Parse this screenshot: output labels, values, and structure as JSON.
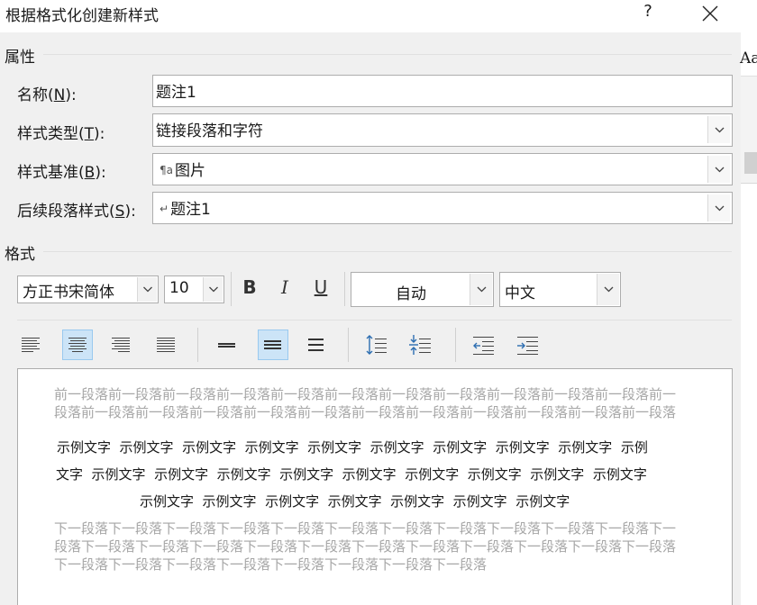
{
  "dialog": {
    "title": "根据格式化创建新样式",
    "help_label": "?"
  },
  "properties": {
    "section_label": "属性",
    "name_label_pre": "名称(",
    "name_label_key": "N",
    "name_label_post": "):",
    "name_value": "题注1",
    "type_label_pre": "样式类型(",
    "type_label_key": "T",
    "type_label_post": "):",
    "type_value": "链接段落和字符",
    "base_label_pre": "样式基准(",
    "base_label_key": "B",
    "base_label_post": "):",
    "base_value": "图片",
    "base_mark": "¶a",
    "next_label_pre": "后续段落样式(",
    "next_label_key": "S",
    "next_label_post": "):",
    "next_value": "题注1",
    "next_mark": "↵"
  },
  "format": {
    "section_label": "格式",
    "font_name": "方正书宋简体",
    "font_size": "10",
    "bold_label": "B",
    "italic_label": "I",
    "underline_label": "U",
    "color_value": "自动",
    "script_value": "中文",
    "active_alignment": "center",
    "active_spacing": "1.5"
  },
  "preview": {
    "prev_text": "前一段落前一段落前一段落前一段落前一段落前一段落前一段落前一段落前一段落前一段落前一段落前一段落前一段落前一段落前一段落前一段落前一段落前一段落前一段落前一段落前一段落前一段落前一段落",
    "sample_line1": "示例文字  示例文字  示例文字  示例文字  示例文字  示例文字  示例文字  示例文字  示例文字  示例",
    "sample_line2": "文字  示例文字  示例文字  示例文字  示例文字  示例文字  示例文字  示例文字  示例文字  示例文字",
    "sample_line3": "示例文字  示例文字  示例文字  示例文字  示例文字  示例文字  示例文字",
    "next_text": "下一段落下一段落下一段落下一段落下一段落下一段落下一段落下一段落下一段落下一段落下一段落下一段落下一段落下一段落下一段落下一段落下一段落下一段落下一段落下一段落下一段落下一段落下一段落下一段落下一段落下一段落下一段落下一段落下一段落下一段落下一段落"
  },
  "background": {
    "partial_text": "Aa"
  },
  "colors": {
    "active_bg": "#cce4f7",
    "accent_blue": "#2b6cb0",
    "preview_gray": "#a6a6a6"
  },
  "icons": {
    "close": "close-icon",
    "dropdown": "chevron-down-icon",
    "align_left": "align-left-icon",
    "align_center": "align-center-icon",
    "align_right": "align-right-icon",
    "justify": "justify-icon",
    "single_spacing": "single-spacing-icon",
    "one_half_spacing": "one-half-spacing-icon",
    "double_spacing": "double-spacing-icon",
    "space_before": "increase-paragraph-spacing-icon",
    "space_after": "decrease-paragraph-spacing-icon",
    "decrease_indent": "decrease-indent-icon",
    "increase_indent": "increase-indent-icon"
  }
}
